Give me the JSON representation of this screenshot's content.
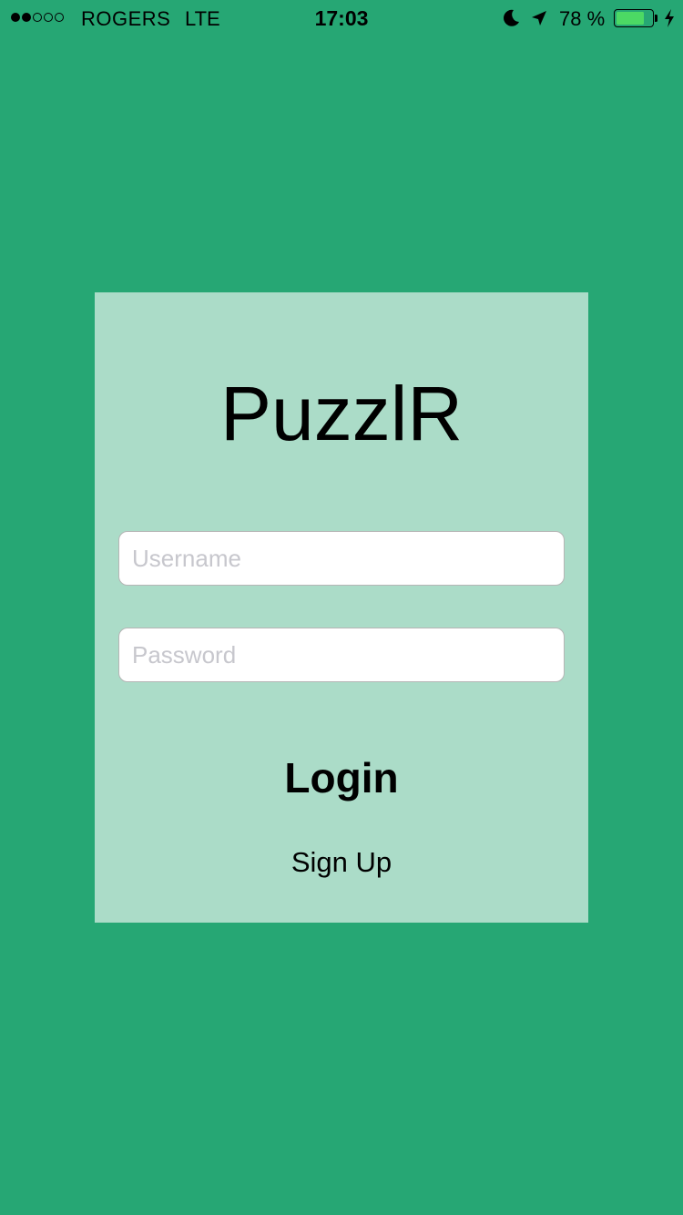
{
  "status_bar": {
    "signal_strength": 2,
    "signal_total": 5,
    "carrier": "ROGERS",
    "network": "LTE",
    "time": "17:03",
    "battery_percent": "78 %",
    "battery_level": 0.78,
    "battery_color": "#4cd964",
    "icons": [
      "moon-icon",
      "location-arrow-icon",
      "battery-icon",
      "charging-bolt-icon"
    ]
  },
  "theme": {
    "background": "#26a774",
    "card_background": "#abdcc8"
  },
  "login_card": {
    "app_title": "PuzzlR",
    "username": {
      "value": "",
      "placeholder": "Username"
    },
    "password": {
      "value": "",
      "placeholder": "Password"
    },
    "login_label": "Login",
    "signup_label": "Sign Up"
  }
}
